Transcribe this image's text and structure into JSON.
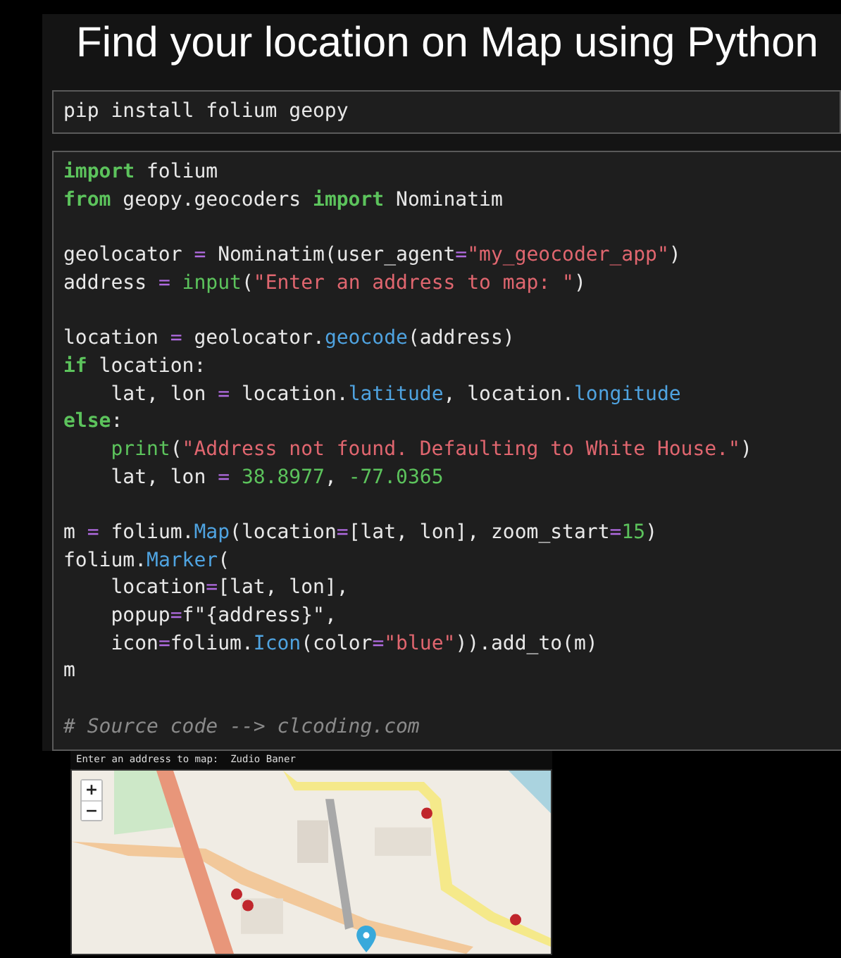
{
  "title": "Find your location on Map using Python",
  "install_cell": {
    "command": "pip install folium geopy"
  },
  "code_cell": {
    "lines": [
      [
        {
          "kind": "keyword",
          "text": "import"
        },
        {
          "kind": "plain",
          "text": " folium"
        }
      ],
      [
        {
          "kind": "keyword",
          "text": "from"
        },
        {
          "kind": "plain",
          "text": " geopy.geocoders "
        },
        {
          "kind": "keyword",
          "text": "import"
        },
        {
          "kind": "plain",
          "text": " Nominatim"
        }
      ],
      [
        {
          "kind": "blank"
        }
      ],
      [
        {
          "kind": "plain",
          "text": "geolocator "
        },
        {
          "kind": "operator",
          "text": "="
        },
        {
          "kind": "plain",
          "text": " Nominatim(user_agent"
        },
        {
          "kind": "operator",
          "text": "="
        },
        {
          "kind": "string",
          "text": "\"my_geocoder_app\""
        },
        {
          "kind": "plain",
          "text": ")"
        }
      ],
      [
        {
          "kind": "plain",
          "text": "address "
        },
        {
          "kind": "operator",
          "text": "="
        },
        {
          "kind": "builtin",
          "text": " input"
        },
        {
          "kind": "plain",
          "text": "("
        },
        {
          "kind": "string",
          "text": "\"Enter an address to map: \""
        },
        {
          "kind": "plain",
          "text": ")"
        }
      ],
      [
        {
          "kind": "blank"
        }
      ],
      [
        {
          "kind": "plain",
          "text": "location "
        },
        {
          "kind": "operator",
          "text": "="
        },
        {
          "kind": "plain",
          "text": " geolocator."
        },
        {
          "kind": "attribute",
          "text": "geocode"
        },
        {
          "kind": "plain",
          "text": "(address)"
        }
      ],
      [
        {
          "kind": "keyword",
          "text": "if"
        },
        {
          "kind": "plain",
          "text": " location:"
        }
      ],
      [
        {
          "kind": "plain",
          "text": "    lat, lon "
        },
        {
          "kind": "operator",
          "text": "="
        },
        {
          "kind": "plain",
          "text": " location."
        },
        {
          "kind": "attribute",
          "text": "latitude"
        },
        {
          "kind": "plain",
          "text": ", location."
        },
        {
          "kind": "attribute",
          "text": "longitude"
        }
      ],
      [
        {
          "kind": "keyword",
          "text": "else"
        },
        {
          "kind": "plain",
          "text": ":"
        }
      ],
      [
        {
          "kind": "builtin",
          "text": "    print"
        },
        {
          "kind": "plain",
          "text": "("
        },
        {
          "kind": "string",
          "text": "\"Address not found. Defaulting to White House.\""
        },
        {
          "kind": "plain",
          "text": ")"
        }
      ],
      [
        {
          "kind": "plain",
          "text": "    lat, lon "
        },
        {
          "kind": "operator",
          "text": "="
        },
        {
          "kind": "number",
          "text": " 38.8977"
        },
        {
          "kind": "plain",
          "text": ", "
        },
        {
          "kind": "number",
          "text": "-77.0365"
        }
      ],
      [
        {
          "kind": "blank"
        }
      ],
      [
        {
          "kind": "plain",
          "text": "m "
        },
        {
          "kind": "operator",
          "text": "="
        },
        {
          "kind": "plain",
          "text": " folium."
        },
        {
          "kind": "attribute",
          "text": "Map"
        },
        {
          "kind": "plain",
          "text": "(location"
        },
        {
          "kind": "operator",
          "text": "="
        },
        {
          "kind": "plain",
          "text": "[lat, lon], zoom_start"
        },
        {
          "kind": "operator",
          "text": "="
        },
        {
          "kind": "number",
          "text": "15"
        },
        {
          "kind": "plain",
          "text": ")"
        }
      ],
      [
        {
          "kind": "plain",
          "text": "folium."
        },
        {
          "kind": "attribute",
          "text": "Marker"
        },
        {
          "kind": "plain",
          "text": "("
        }
      ],
      [
        {
          "kind": "plain",
          "text": "    location"
        },
        {
          "kind": "operator",
          "text": "="
        },
        {
          "kind": "plain",
          "text": "[lat, lon],"
        }
      ],
      [
        {
          "kind": "plain",
          "text": "    popup"
        },
        {
          "kind": "operator",
          "text": "="
        },
        {
          "kind": "plain",
          "text": "f\"{address}\","
        }
      ],
      [
        {
          "kind": "plain",
          "text": "    icon"
        },
        {
          "kind": "operator",
          "text": "="
        },
        {
          "kind": "plain",
          "text": "folium."
        },
        {
          "kind": "attribute",
          "text": "Icon"
        },
        {
          "kind": "plain",
          "text": "(color"
        },
        {
          "kind": "operator",
          "text": "="
        },
        {
          "kind": "string",
          "text": "\"blue\""
        },
        {
          "kind": "plain",
          "text": ")).add_to(m)"
        }
      ],
      [
        {
          "kind": "plain",
          "text": "m"
        }
      ],
      [
        {
          "kind": "blank"
        }
      ],
      [
        {
          "kind": "comment",
          "text": "# Source code --> clcoding.com"
        }
      ]
    ]
  },
  "output": {
    "prompt": "Enter an address to map:  Zudio Baner",
    "map": {
      "kind": "picture",
      "zoom_in": "+",
      "zoom_out": "−"
    }
  }
}
